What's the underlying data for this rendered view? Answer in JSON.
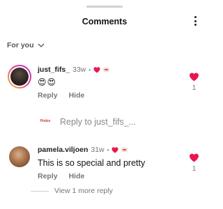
{
  "header": {
    "title": "Comments"
  },
  "filter": {
    "label": "For you"
  },
  "comments": [
    {
      "username": "just_fifs_",
      "time": "33w",
      "text": "😍😍",
      "reply_label": "Reply",
      "hide_label": "Hide",
      "like_count": "1"
    },
    {
      "username": "pamela.viljoen",
      "time": "31w",
      "text": "This is so special and pretty",
      "reply_label": "Reply",
      "hide_label": "Hide",
      "like_count": "1"
    }
  ],
  "reply_box": {
    "placeholder": "Reply to just_fifs_..."
  },
  "view_replies": {
    "label": "View 1 more reply"
  },
  "colors": {
    "heart": "#e8174b",
    "muted_text": "#777777"
  }
}
